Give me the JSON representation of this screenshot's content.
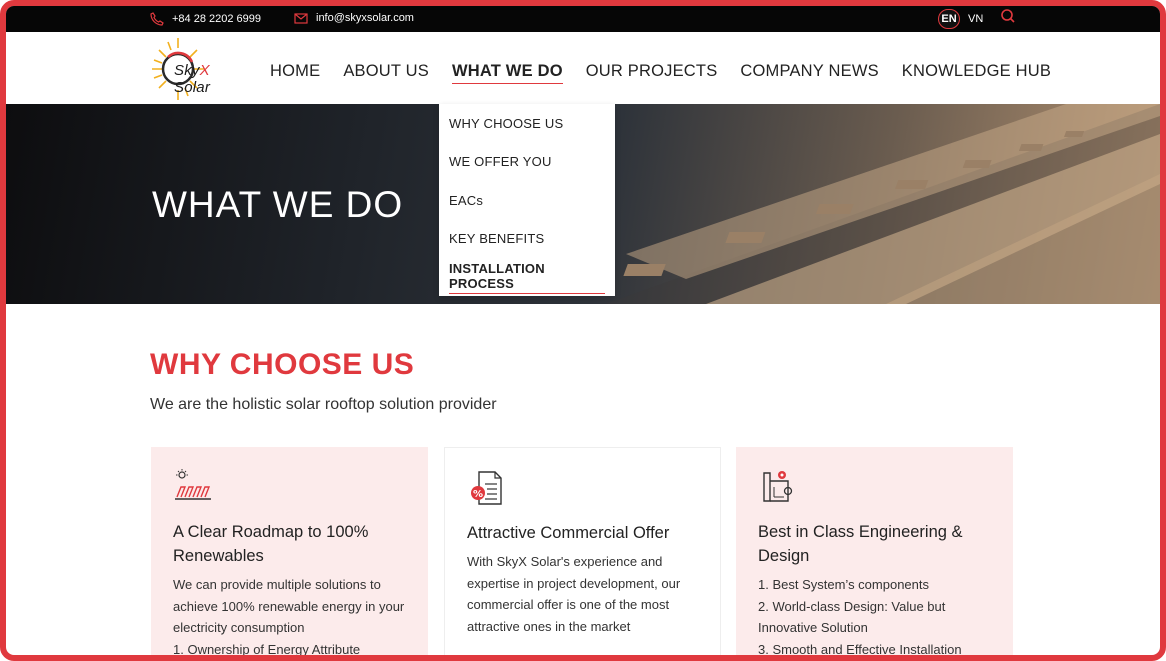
{
  "topbar": {
    "phone": "+84 28 2202 6999",
    "email": "info@skyxsolar.com",
    "lang_en": "EN",
    "lang_vn": "VN"
  },
  "logo": {
    "brand_sky": "Sky",
    "brand_x": "X",
    "brand_solar": " Solar"
  },
  "nav": {
    "items": [
      "HOME",
      "ABOUT US",
      "WHAT WE DO",
      "OUR PROJECTS",
      "COMPANY NEWS",
      "KNOWLEDGE HUB"
    ],
    "active_index": 2
  },
  "hero": {
    "title": "WHAT WE DO"
  },
  "dropdown": {
    "items": [
      "WHY CHOOSE US",
      "WE OFFER YOU",
      "EACs",
      "KEY BENEFITS",
      "INSTALLATION PROCESS"
    ],
    "active_index": 4
  },
  "section": {
    "title": "WHY CHOOSE US",
    "subtitle": "We are the holistic solar rooftop solution provider"
  },
  "cards": [
    {
      "icon": "solar-roadmap-icon",
      "title": "A Clear Roadmap to 100% Renewables",
      "body": "We can provide multiple solutions to achieve 100% renewable energy in your electricity consumption",
      "body2": "1. Ownership of Energy Attribute"
    },
    {
      "icon": "commercial-offer-icon",
      "title": "Attractive Commercial Offer",
      "body": "With SkyX Solar's experience and expertise in project development, our commercial offer is one of the most attractive ones in the market",
      "body2": ""
    },
    {
      "icon": "engineering-design-icon",
      "title": "Best in Class Engineering & Design",
      "body": "1. Best System’s components",
      "body2": "2. World-class Design: Value but Innovative Solution",
      "body3": "3. Smooth and Effective Installation"
    }
  ],
  "colors": {
    "accent": "#e0393e",
    "topbar": "#060606",
    "card_pink": "#fcebeb"
  }
}
